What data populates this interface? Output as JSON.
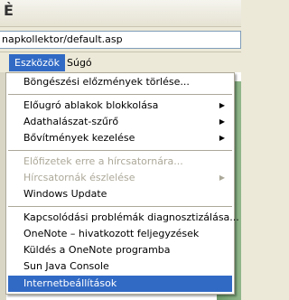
{
  "address": {
    "value": "napkollektor/default.asp"
  },
  "menubar": {
    "items": [
      "Eszközök",
      "Súgó"
    ]
  },
  "menu": {
    "items": [
      {
        "label": "Böngészési előzmények törlése...",
        "disabled": false,
        "submenu": false
      },
      {
        "label": "Előugró ablakok blokkolása",
        "disabled": false,
        "submenu": true
      },
      {
        "label": "Adathalászat-szűrő",
        "disabled": false,
        "submenu": true
      },
      {
        "label": "Bővítmények kezelése",
        "disabled": false,
        "submenu": true
      },
      {
        "label": "Előfizetek erre a hírcsatornára...",
        "disabled": true,
        "submenu": false
      },
      {
        "label": "Hírcsatornák észlelése",
        "disabled": true,
        "submenu": true
      },
      {
        "label": "Windows Update",
        "disabled": false,
        "submenu": false
      },
      {
        "label": "Kapcsolódási problémák diagnosztizálása...",
        "disabled": false,
        "submenu": false
      },
      {
        "label": "OneNote – hivatkozott feljegyzések",
        "disabled": false,
        "submenu": false
      },
      {
        "label": "Küldés a OneNote programba",
        "disabled": false,
        "submenu": false
      },
      {
        "label": "Sun Java Console",
        "disabled": false,
        "submenu": false
      },
      {
        "label": "Internetbeállítások",
        "disabled": false,
        "submenu": false,
        "highlighted": true
      }
    ]
  },
  "colors": {
    "highlight": "#316ac5",
    "disabled_text": "#aca899",
    "page_accent": "#7aa874"
  }
}
